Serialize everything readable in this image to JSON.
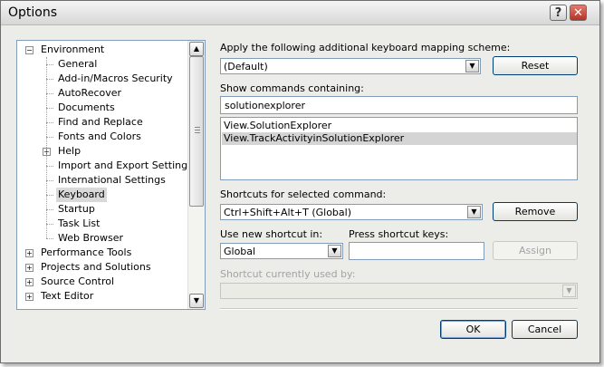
{
  "window": {
    "title": "Options"
  },
  "tree": {
    "items": [
      {
        "label": "Environment",
        "level": 0,
        "expander": "−"
      },
      {
        "label": "General",
        "level": 1
      },
      {
        "label": "Add-in/Macros Security",
        "level": 1
      },
      {
        "label": "AutoRecover",
        "level": 1
      },
      {
        "label": "Documents",
        "level": 1
      },
      {
        "label": "Find and Replace",
        "level": 1
      },
      {
        "label": "Fonts and Colors",
        "level": 1
      },
      {
        "label": "Help",
        "level": 1,
        "expander": "+"
      },
      {
        "label": "Import and Export Settings",
        "level": 1
      },
      {
        "label": "International Settings",
        "level": 1
      },
      {
        "label": "Keyboard",
        "level": 1,
        "selected": true
      },
      {
        "label": "Startup",
        "level": 1
      },
      {
        "label": "Task List",
        "level": 1
      },
      {
        "label": "Web Browser",
        "level": 1
      },
      {
        "label": "Performance Tools",
        "level": 0,
        "expander": "+"
      },
      {
        "label": "Projects and Solutions",
        "level": 0,
        "expander": "+"
      },
      {
        "label": "Source Control",
        "level": 0,
        "expander": "+"
      },
      {
        "label": "Text Editor",
        "level": 0,
        "expander": "+"
      }
    ]
  },
  "mapping": {
    "label": "Apply the following additional keyboard mapping scheme:",
    "value": "(Default)",
    "reset_label": "Reset"
  },
  "commands": {
    "label": "Show commands containing:",
    "filter_value": "solutionexplorer",
    "items": [
      "View.SolutionExplorer",
      "View.TrackActivityinSolutionExplorer"
    ],
    "selected_index": 1
  },
  "shortcuts": {
    "label": "Shortcuts for selected command:",
    "value": "Ctrl+Shift+Alt+T (Global)",
    "remove_label": "Remove"
  },
  "new_shortcut": {
    "use_in_label": "Use new shortcut in:",
    "use_in_value": "Global",
    "press_keys_label": "Press shortcut keys:",
    "press_keys_value": "",
    "assign_label": "Assign"
  },
  "used_by": {
    "label": "Shortcut currently used by:",
    "value": ""
  },
  "footer": {
    "ok_label": "OK",
    "cancel_label": "Cancel"
  },
  "icons": {
    "expand": "plus-box",
    "collapse": "minus-box",
    "dropdown": "chevron-down",
    "scroll_up": "arrow-up",
    "scroll_down": "arrow-down"
  }
}
